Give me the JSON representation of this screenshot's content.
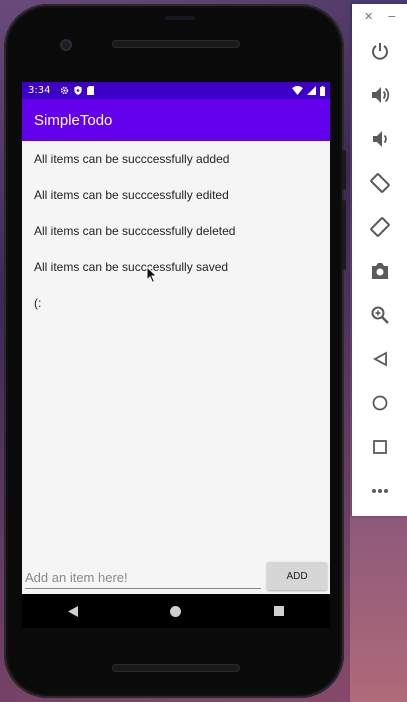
{
  "status_bar": {
    "time": "3:34",
    "left_icons": [
      "gear-icon",
      "shield-icon",
      "sd-card-icon"
    ],
    "right_icons": [
      "wifi-icon",
      "cell-signal-icon",
      "battery-icon"
    ]
  },
  "app_bar": {
    "title": "SimpleTodo"
  },
  "todo_items": [
    "All items can be succcessfully added",
    "All items can be succcessfully edited",
    "All items can be succcessfully deleted",
    "All items can be succcessfully saved",
    "(:"
  ],
  "input": {
    "placeholder": "Add an item here!",
    "value": ""
  },
  "add_button": {
    "label": "ADD"
  },
  "nav_bar": [
    "back-icon",
    "home-icon",
    "overview-icon"
  ],
  "emulator_panel": {
    "header": {
      "close": "✕",
      "minimize": "−"
    },
    "buttons": [
      "power-icon",
      "volume-up-icon",
      "volume-down-icon",
      "rotate-left-icon",
      "rotate-right-icon",
      "camera-icon",
      "zoom-icon",
      "back-icon",
      "home-icon",
      "overview-icon",
      "more-icon"
    ]
  },
  "colors": {
    "status_bar": "#3d00c6",
    "app_bar": "#6200ee",
    "screen_bg": "#f5f5f5",
    "add_button_bg": "#d6d6d6",
    "emulator_icon": "#5a5a5a"
  }
}
